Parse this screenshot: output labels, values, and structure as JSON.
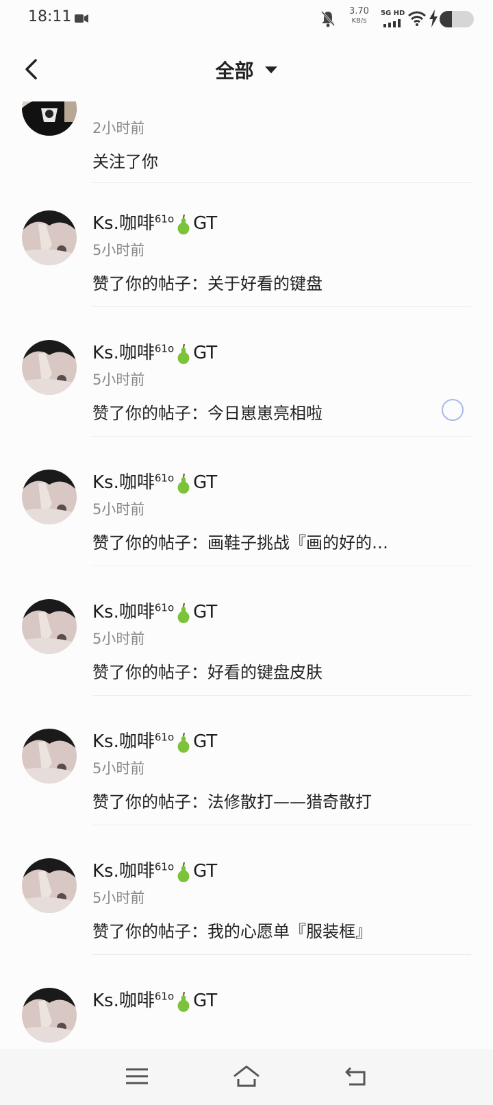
{
  "status": {
    "time": "18:11",
    "speed_value": "3.70",
    "speed_unit": "KB/s",
    "network": "5G HD",
    "battery_percent": 35
  },
  "header": {
    "title": "全部"
  },
  "notifications": [
    {
      "name": "",
      "time": "2小时前",
      "text": "关注了你",
      "avatar": "dark-shirt-avatar"
    },
    {
      "name_main": "Ks.咖啡",
      "name_sup": "61o",
      "name_tail": "GT",
      "time": "5小时前",
      "text": "赞了你的帖子：关于好看的键盘",
      "avatar": "hand-face-avatar"
    },
    {
      "name_main": "Ks.咖啡",
      "name_sup": "61o",
      "name_tail": "GT",
      "time": "5小时前",
      "text": "赞了你的帖子：今日崽崽亮相啦",
      "avatar": "hand-face-avatar"
    },
    {
      "name_main": "Ks.咖啡",
      "name_sup": "61o",
      "name_tail": "GT",
      "time": "5小时前",
      "text": "赞了你的帖子：画鞋子挑战『画的好的…",
      "avatar": "hand-face-avatar"
    },
    {
      "name_main": "Ks.咖啡",
      "name_sup": "61o",
      "name_tail": "GT",
      "time": "5小时前",
      "text": "赞了你的帖子：好看的键盘皮肤",
      "avatar": "hand-face-avatar"
    },
    {
      "name_main": "Ks.咖啡",
      "name_sup": "61o",
      "name_tail": "GT",
      "time": "5小时前",
      "text": "赞了你的帖子：法修散打——猎奇散打",
      "avatar": "hand-face-avatar"
    },
    {
      "name_main": "Ks.咖啡",
      "name_sup": "61o",
      "name_tail": "GT",
      "time": "5小时前",
      "text": "赞了你的帖子：我的心愿单『服装框』",
      "avatar": "hand-face-avatar"
    },
    {
      "name_main": "Ks.咖啡",
      "name_sup": "61o",
      "name_tail": "GT",
      "time": "",
      "text": "",
      "avatar": "hand-face-avatar"
    }
  ],
  "colors": {
    "pear": "#7cc23a",
    "loader": "#a9b8e8"
  },
  "icons": {
    "back": "back-arrow-icon",
    "dropdown": "caret-down-icon",
    "menu": "menu-icon",
    "home": "home-icon",
    "return": "return-icon"
  }
}
